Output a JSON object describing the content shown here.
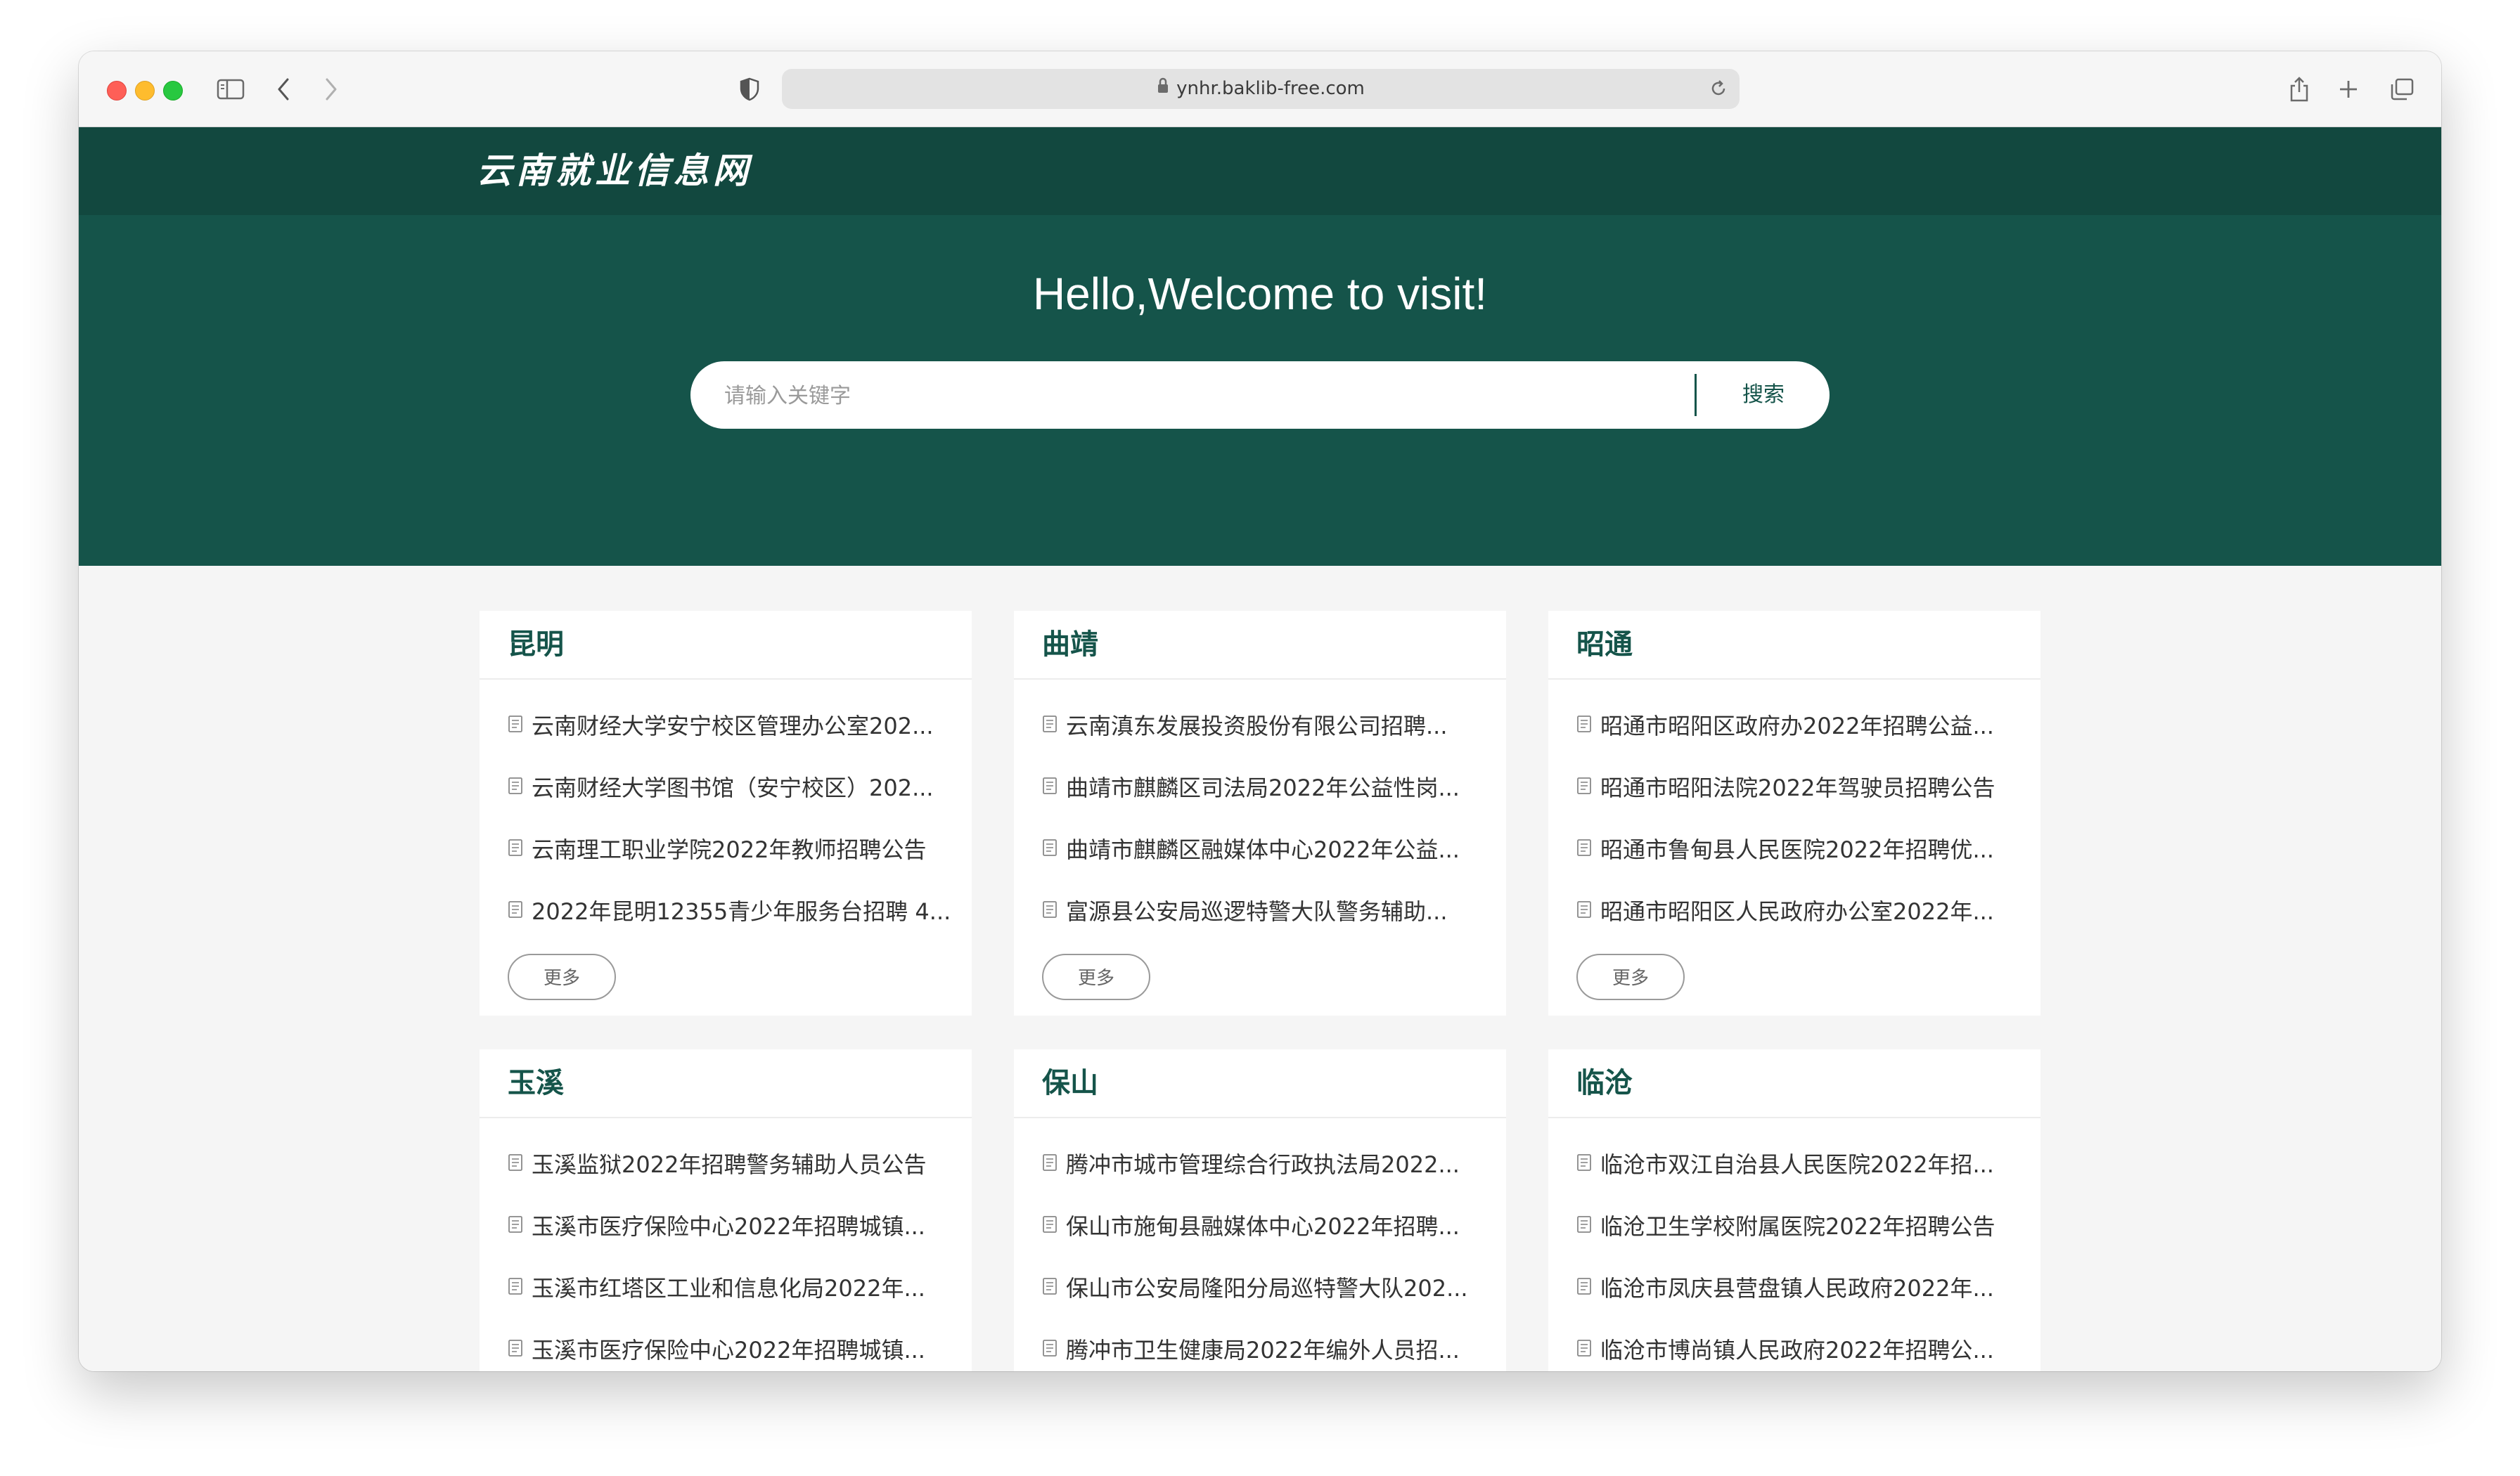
{
  "browser": {
    "url": "ynhr.baklib-free.com"
  },
  "site": {
    "logo": "云南就业信息网",
    "welcome": "Hello,Welcome to visit!",
    "search_placeholder": "请输入关键字",
    "search_button": "搜索",
    "more_label": "更多"
  },
  "cards": [
    {
      "title": "昆明",
      "items": [
        "云南财经大学安宁校区管理办公室202...",
        "云南财经大学图书馆（安宁校区）202...",
        "云南理工职业学院2022年教师招聘公告",
        "2022年昆明12355青少年服务台招聘 4..."
      ]
    },
    {
      "title": "曲靖",
      "items": [
        "云南滇东发展投资股份有限公司招聘...",
        "曲靖市麒麟区司法局2022年公益性岗...",
        "曲靖市麒麟区融媒体中心2022年公益...",
        "富源县公安局巡逻特警大队警务辅助..."
      ]
    },
    {
      "title": "昭通",
      "items": [
        "昭通市昭阳区政府办2022年招聘公益...",
        "昭通市昭阳法院2022年驾驶员招聘公告",
        "昭通市鲁甸县人民医院2022年招聘优...",
        "昭通市昭阳区人民政府办公室2022年..."
      ]
    },
    {
      "title": "玉溪",
      "items": [
        "玉溪监狱2022年招聘警务辅助人员公告",
        "玉溪市医疗保险中心2022年招聘城镇...",
        "玉溪市红塔区工业和信息化局2022年...",
        "玉溪市医疗保险中心2022年招聘城镇..."
      ]
    },
    {
      "title": "保山",
      "items": [
        "腾冲市城市管理综合行政执法局2022...",
        "保山市施甸县融媒体中心2022年招聘...",
        "保山市公安局隆阳分局巡特警大队202...",
        "腾冲市卫生健康局2022年编外人员招..."
      ]
    },
    {
      "title": "临沧",
      "items": [
        "临沧市双江自治县人民医院2022年招...",
        "临沧卫生学校附属医院2022年招聘公告",
        "临沧市凤庆县营盘镇人民政府2022年...",
        "临沧市博尚镇人民政府2022年招聘公..."
      ]
    }
  ]
}
